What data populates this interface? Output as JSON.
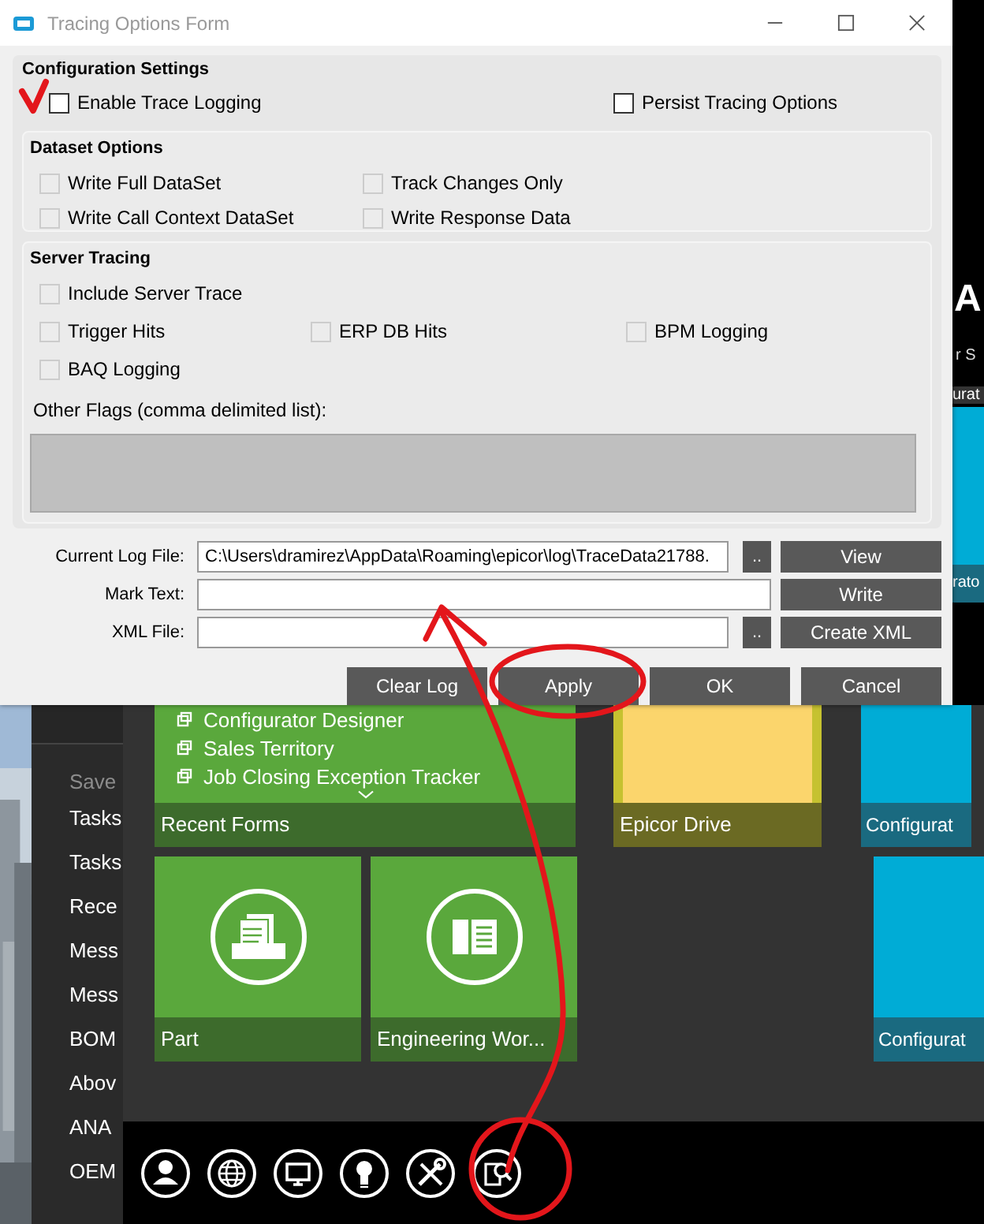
{
  "window": {
    "title": "Tracing Options Form"
  },
  "configuration_settings": {
    "title": "Configuration Settings",
    "options": [
      {
        "label": "Enable Trace Logging",
        "checked": false,
        "disabled": false
      },
      {
        "label": "Persist Tracing Options",
        "checked": false,
        "disabled": false
      }
    ]
  },
  "dataset_options": {
    "title": "Dataset Options",
    "rows": [
      [
        {
          "label": "Write Full DataSet",
          "checked": false,
          "disabled": true
        },
        {
          "label": "Track Changes Only",
          "checked": false,
          "disabled": true
        }
      ],
      [
        {
          "label": "Write Call Context DataSet",
          "checked": false,
          "disabled": true
        },
        {
          "label": "Write Response Data",
          "checked": false,
          "disabled": true
        }
      ]
    ]
  },
  "server_tracing": {
    "title": "Server Tracing",
    "rows": [
      [
        {
          "label": "Include Server Trace",
          "checked": false,
          "disabled": true
        }
      ],
      [
        {
          "label": "Trigger Hits",
          "checked": false,
          "disabled": true
        },
        {
          "label": "ERP DB Hits",
          "checked": false,
          "disabled": true
        },
        {
          "label": "BPM Logging",
          "checked": false,
          "disabled": true
        }
      ],
      [
        {
          "label": "BAQ Logging",
          "checked": false,
          "disabled": true
        }
      ]
    ],
    "other_flags": {
      "label": "Other Flags (comma delimited list):",
      "disabled": true
    }
  },
  "log_fields": [
    {
      "label": "Current Log File:",
      "value": "C:\\Users\\dramirez\\AppData\\Roaming\\epicor\\log\\TraceData21788.",
      "browse": "..",
      "action": "View"
    },
    {
      "label": "Mark Text:",
      "action": "Write"
    },
    {
      "label": "XML File:",
      "browse": "..",
      "action": "Create XML"
    }
  ],
  "buttons": [
    "Clear Log",
    "Apply",
    "OK",
    "Cancel"
  ],
  "background": {
    "right_edge": {
      "logo": "A",
      "tagline": "r S",
      "tile_title": "urat",
      "tile_label": "rato"
    },
    "sidebar": {
      "heading": "Save",
      "items": [
        "Tasks",
        "Tasks",
        "Rece",
        "Mess",
        "Mess",
        "BOM",
        "Abov",
        "ANA",
        "OEM"
      ]
    },
    "recent_forms": {
      "items": [
        "Configurator Designer",
        "Sales Territory",
        "Job Closing Exception Tracker"
      ],
      "label": "Recent Forms"
    },
    "tiles_row_1": [
      {
        "kind": "drive",
        "label": "Epicor Drive"
      },
      {
        "kind": "form",
        "label": "Configurat"
      }
    ],
    "tiles_row_2": [
      {
        "kind": "part",
        "label": "Part"
      },
      {
        "kind": "book",
        "label": "Engineering Wor..."
      },
      {
        "kind": "empty"
      },
      {
        "kind": "form",
        "label": "Configurat"
      }
    ]
  }
}
